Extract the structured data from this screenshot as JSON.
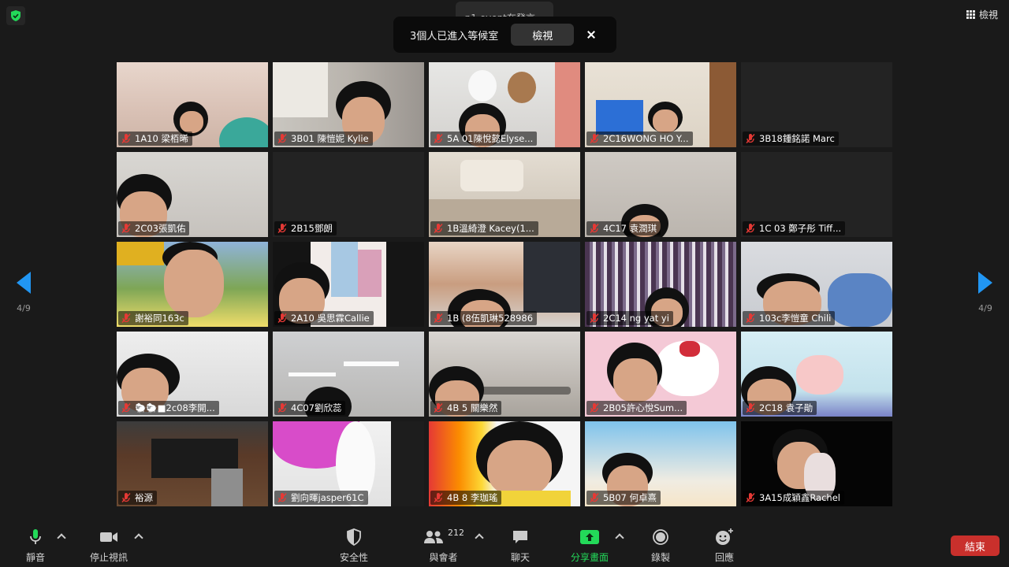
{
  "top": {
    "view_label": "檢視",
    "speaker_label": "p1 event在發言..."
  },
  "banner": {
    "message": "3個人已進入等候室",
    "button_label": "檢視"
  },
  "nav": {
    "page_left": "4/9",
    "page_right": "4/9"
  },
  "participants": [
    {
      "name": "1A10 梁栢晞"
    },
    {
      "name": "3B01 陳愷妮 Kylie"
    },
    {
      "name": "5A 01陳悅懿Elyse..."
    },
    {
      "name": "2C16WONG HO Y..."
    },
    {
      "name": "3B18鍾銘諾 Marc"
    },
    {
      "name": "2C03張凱佑"
    },
    {
      "name": "2B15鄧朗"
    },
    {
      "name": "1B溫綺澄 Kacey(1..."
    },
    {
      "name": "4C17 袁潤琪"
    },
    {
      "name": "1C 03 鄭子彤 Tiff..."
    },
    {
      "name": "謝裕同163c"
    },
    {
      "name": "2A10 吳思霖Callie"
    },
    {
      "name": "1B (8伍凱琳528986"
    },
    {
      "name": "2C14 ng yat yi"
    },
    {
      "name": "103c李愷童 Chili"
    },
    {
      "name": "🐑🐑■2c08李開..."
    },
    {
      "name": "4C07劉欣蕊"
    },
    {
      "name": "4B 5 關樂然"
    },
    {
      "name": "2B05許心悅Sum..."
    },
    {
      "name": "2C18 袁子勛"
    },
    {
      "name": "裕源"
    },
    {
      "name": "劉向暉jasper61C"
    },
    {
      "name": "4B 8 李珈瑤"
    },
    {
      "name": "5B07 何卓熹"
    },
    {
      "name": "3A15成穎鑫Rachel"
    }
  ],
  "toolbar": {
    "mute_label": "靜音",
    "video_label": "停止視訊",
    "security_label": "安全性",
    "participants_label": "與會者",
    "participants_count": "212",
    "chat_label": "聊天",
    "share_label": "分享畫面",
    "record_label": "錄製",
    "reactions_label": "回應",
    "end_label": "結束"
  },
  "colors": {
    "accent_blue": "#2196f3",
    "share_green": "#23d959",
    "end_red": "#c9302c",
    "mute_red": "#e53935"
  }
}
